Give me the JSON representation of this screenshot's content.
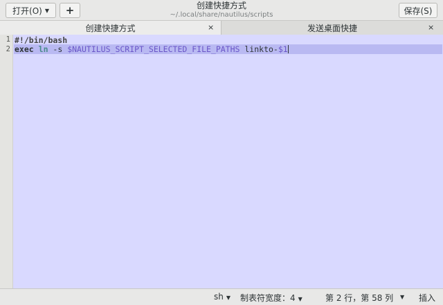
{
  "header": {
    "open_label": "打开(O)",
    "new_label": "+",
    "title": "创建快捷方式",
    "subtitle": "~/.local/share/nautilus/scripts",
    "save_label": "保存(S)"
  },
  "tabs": [
    {
      "label": "创建快捷方式",
      "close": "×",
      "active": true
    },
    {
      "label": "发送桌面快捷",
      "close": "×",
      "active": false
    }
  ],
  "editor": {
    "line_numbers": [
      "1",
      "2"
    ],
    "lines": [
      {
        "text": "#!/bin/bash"
      },
      {
        "tokens": [
          "exec",
          " ",
          "ln",
          " -s ",
          "$NAUTILUS_SCRIPT_SELECTED_FILE_PATHS",
          " linkto-",
          "$1"
        ]
      }
    ]
  },
  "statusbar": {
    "language": "sh",
    "tab_width": "制表符宽度：4",
    "position": "第 2 行，第 58 列",
    "mode": "插入"
  },
  "colors": {
    "editor_bg": "#d9d9ff",
    "current_line_bg": "#b9b9f2",
    "variable": "#6a56c8",
    "command": "#4a8b8b"
  }
}
